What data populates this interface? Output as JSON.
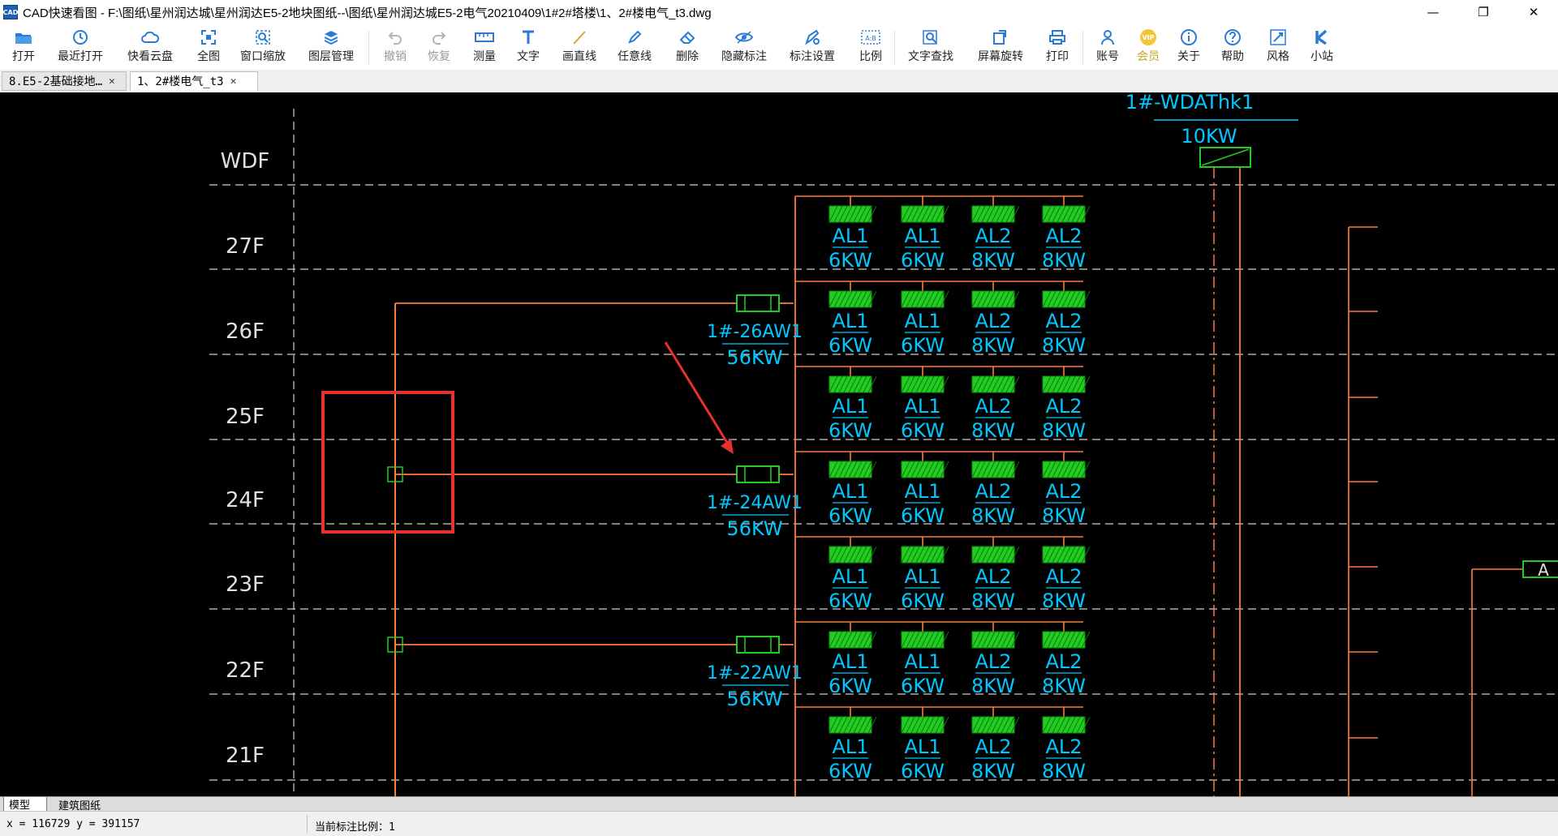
{
  "window": {
    "app_icon_text": "CAD",
    "title": "CAD快速看图 - F:\\图纸\\星州润达城\\星州润达E5-2地块图纸--\\图纸\\星州润达城E5-2电气20210409\\1#2#塔楼\\1、2#楼电气_t3.dwg",
    "controls": {
      "minimize": "—",
      "maximize": "❐",
      "close": "✕"
    }
  },
  "toolbar": {
    "items": [
      {
        "id": "open",
        "label": "打开",
        "icon": "folder-icon"
      },
      {
        "id": "recent",
        "label": "最近打开",
        "icon": "clock-icon"
      },
      {
        "id": "cloud",
        "label": "快看云盘",
        "icon": "cloud-icon"
      },
      {
        "id": "fullview",
        "label": "全图",
        "icon": "fullview-icon"
      },
      {
        "id": "zoomwin",
        "label": "窗口缩放",
        "icon": "zoom-window-icon"
      },
      {
        "id": "layers",
        "label": "图层管理",
        "icon": "layers-icon"
      },
      {
        "id": "undo",
        "label": "撤销",
        "icon": "undo-icon",
        "disabled": true
      },
      {
        "id": "redo",
        "label": "恢复",
        "icon": "redo-icon",
        "disabled": true
      },
      {
        "id": "measure",
        "label": "测量",
        "icon": "ruler-icon"
      },
      {
        "id": "text",
        "label": "文字",
        "icon": "text-icon"
      },
      {
        "id": "line",
        "label": "画直线",
        "icon": "line-icon"
      },
      {
        "id": "freeline",
        "label": "任意线",
        "icon": "pen-icon"
      },
      {
        "id": "delete",
        "label": "删除",
        "icon": "eraser-icon"
      },
      {
        "id": "hidemark",
        "label": "隐藏标注",
        "icon": "eye-icon"
      },
      {
        "id": "marksettings",
        "label": "标注设置",
        "icon": "mark-settings-icon"
      },
      {
        "id": "scale",
        "label": "比例",
        "icon": "scale-icon"
      },
      {
        "id": "findtext",
        "label": "文字查找",
        "icon": "find-text-icon"
      },
      {
        "id": "rotate",
        "label": "屏幕旋转",
        "icon": "rotate-icon"
      },
      {
        "id": "print",
        "label": "打印",
        "icon": "printer-icon"
      },
      {
        "id": "account",
        "label": "账号",
        "icon": "user-icon"
      },
      {
        "id": "vip",
        "label": "会员",
        "icon": "vip-icon"
      },
      {
        "id": "about",
        "label": "关于",
        "icon": "info-icon"
      },
      {
        "id": "help",
        "label": "帮助",
        "icon": "help-icon"
      },
      {
        "id": "style",
        "label": "风格",
        "icon": "style-icon"
      },
      {
        "id": "site",
        "label": "小站",
        "icon": "k-icon"
      }
    ],
    "vip_icon_text": "VIP",
    "scale_icon_text": "A:B"
  },
  "tabs": [
    {
      "label": "8.E5-2基础接地…",
      "close": "✕",
      "active": false
    },
    {
      "label": "1、2#楼电气_t3",
      "close": "✕",
      "active": true
    }
  ],
  "drawing": {
    "floors": [
      "WDF",
      "27F",
      "26F",
      "25F",
      "24F",
      "23F",
      "22F",
      "21F"
    ],
    "top_panel": {
      "name": "1#-WDAThk1",
      "power": "10KW"
    },
    "riser_panels": [
      {
        "name": "1#-26AW1",
        "power": "56KW"
      },
      {
        "name": "1#-24AW1",
        "power": "56KW"
      },
      {
        "name": "1#-22AW1",
        "power": "56KW"
      }
    ],
    "box_labels": [
      {
        "name": "AL1",
        "power": "6KW"
      },
      {
        "name": "AL1",
        "power": "6KW"
      },
      {
        "name": "AL2",
        "power": "8KW"
      },
      {
        "name": "AL2",
        "power": "8KW"
      }
    ],
    "edge_label": "A",
    "colors": {
      "background": "#000000",
      "riser": "#ff7b3a",
      "dashed": "#cfcfcf",
      "panel": "#22cc22",
      "label": "#00c8ff",
      "highlight": "#e8302c"
    }
  },
  "layout_tabs": [
    {
      "label": "模型",
      "active": true
    },
    {
      "label": "建筑图纸",
      "active": false
    }
  ],
  "status": {
    "coords": "x = 116729  y = 391157",
    "scale": "当前标注比例：1"
  }
}
